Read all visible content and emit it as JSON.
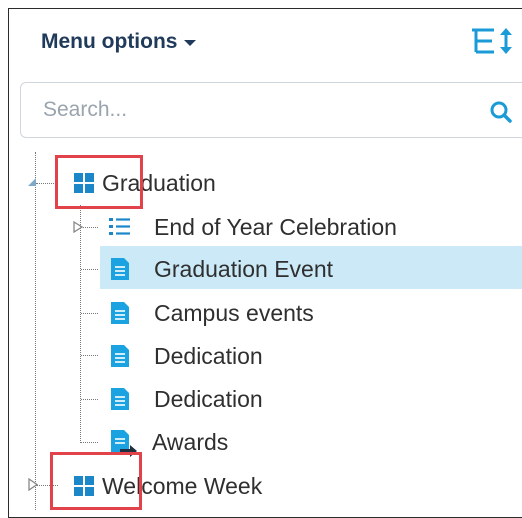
{
  "header": {
    "menu_label": "Menu options"
  },
  "search": {
    "placeholder": "Search..."
  },
  "tree": {
    "groups": [
      {
        "label": "Graduation",
        "children": [
          {
            "label": "End of Year Celebration",
            "icon": "list-icon"
          },
          {
            "label": "Graduation Event",
            "icon": "page-icon",
            "selected": true
          },
          {
            "label": "Campus events",
            "icon": "page-icon"
          },
          {
            "label": "Dedication",
            "icon": "page-icon"
          },
          {
            "label": "Dedication",
            "icon": "page-icon"
          },
          {
            "label": "Awards",
            "icon": "page-link-icon"
          }
        ]
      },
      {
        "label": "Welcome Week",
        "children": []
      }
    ]
  },
  "colors": {
    "accent": "#1a9bd7",
    "selected_bg": "#cbe9f7",
    "callout_red": "#e2434b",
    "header_text": "#1f3a5a"
  }
}
